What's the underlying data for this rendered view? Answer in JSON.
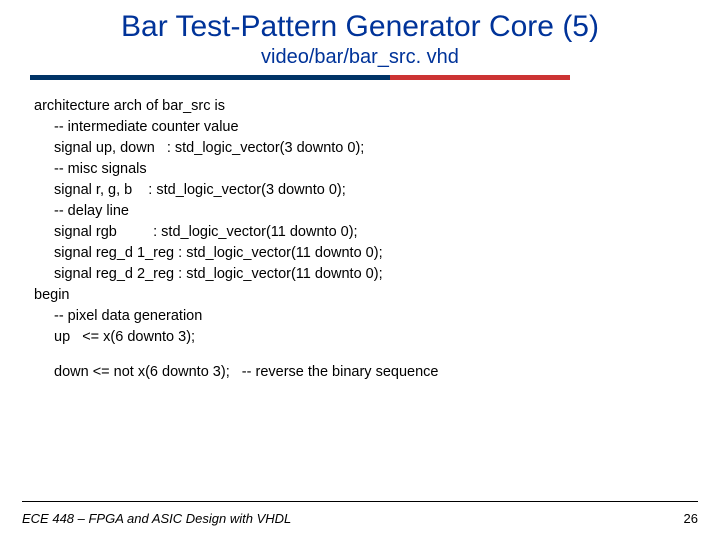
{
  "title": "Bar Test-Pattern Generator Core (5)",
  "subtitle": "video/bar/bar_src. vhd",
  "code": {
    "l0": "architecture arch of bar_src is",
    "l1": "-- intermediate counter value",
    "l2": "signal up, down   : std_logic_vector(3 downto 0);",
    "l3": "-- misc signals",
    "l4": "signal r, g, b    : std_logic_vector(3 downto 0);",
    "l5": "-- delay line",
    "l6": "signal rgb         : std_logic_vector(11 downto 0);",
    "l7": "signal reg_d 1_reg : std_logic_vector(11 downto 0);",
    "l8": "signal reg_d 2_reg : std_logic_vector(11 downto 0);",
    "l9": "begin",
    "l10": "-- pixel data generation",
    "l11": "up   <= x(6 downto 3);",
    "l12": "down <= not x(6 downto 3);   -- reverse the binary sequence"
  },
  "footer": "ECE 448 – FPGA and ASIC Design with VHDL",
  "page": "26"
}
